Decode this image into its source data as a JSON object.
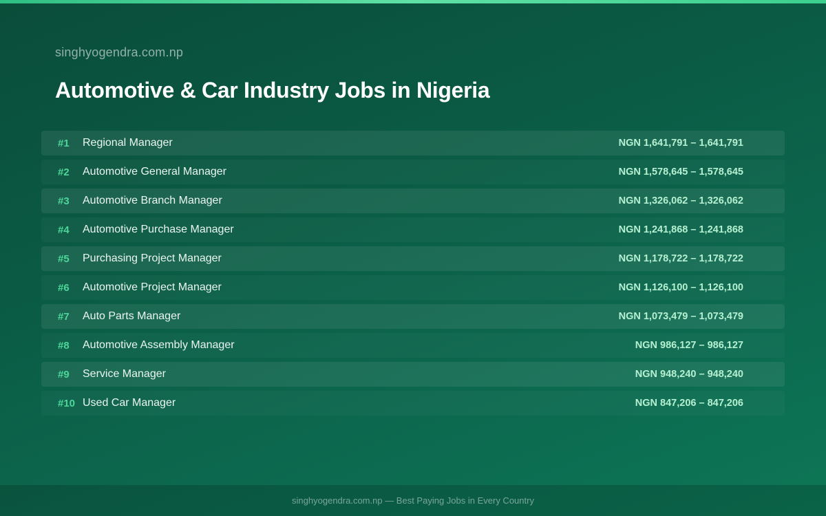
{
  "header": {
    "site_name": "singhyogendra.com.np",
    "title": "Automotive & Car Industry Jobs in Nigeria"
  },
  "jobs": [
    {
      "rank": "#1",
      "title": "Regional Manager",
      "salary": "NGN 1,641,791 – 1,641,791"
    },
    {
      "rank": "#2",
      "title": "Automotive General Manager",
      "salary": "NGN 1,578,645 – 1,578,645"
    },
    {
      "rank": "#3",
      "title": "Automotive Branch Manager",
      "salary": "NGN 1,326,062 – 1,326,062"
    },
    {
      "rank": "#4",
      "title": "Automotive Purchase Manager",
      "salary": "NGN 1,241,868 – 1,241,868"
    },
    {
      "rank": "#5",
      "title": "Purchasing Project Manager",
      "salary": "NGN 1,178,722 – 1,178,722"
    },
    {
      "rank": "#6",
      "title": "Automotive Project Manager",
      "salary": "NGN 1,126,100 – 1,126,100"
    },
    {
      "rank": "#7",
      "title": "Auto Parts Manager",
      "salary": "NGN 1,073,479 – 1,073,479"
    },
    {
      "rank": "#8",
      "title": "Automotive Assembly Manager",
      "salary": "NGN 986,127 – 986,127"
    },
    {
      "rank": "#9",
      "title": "Service Manager",
      "salary": "NGN 948,240 – 948,240"
    },
    {
      "rank": "#10",
      "title": "Used Car Manager",
      "salary": "NGN 847,206 – 847,206"
    }
  ],
  "footer": {
    "text": "singhyogendra.com.np — Best Paying Jobs in Every Country"
  },
  "colors": {
    "accent": "#4cd69a",
    "salary": "#b5f0d2",
    "background_start": "#0a4d3a",
    "background_end": "#0d7655"
  }
}
